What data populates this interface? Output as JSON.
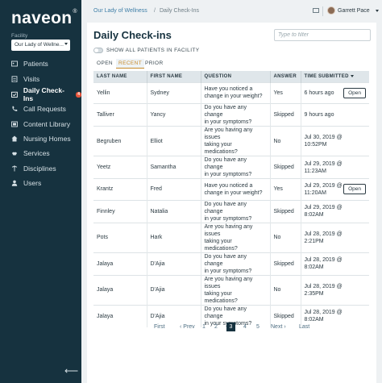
{
  "brand": {
    "logo_text": "naveon",
    "trademark": "®"
  },
  "facility": {
    "label": "Facility",
    "selected": "Our Lady of Wellne..."
  },
  "sidebar": {
    "items": [
      {
        "label": "Patients",
        "icon": "id-card-icon",
        "active": false
      },
      {
        "label": "Visits",
        "icon": "clipboard-icon",
        "active": false
      },
      {
        "label": "Daily Check-Ins",
        "icon": "calendar-check-icon",
        "active": true,
        "badge": "4"
      },
      {
        "label": "Call Requests",
        "icon": "phone-icon",
        "active": false
      },
      {
        "label": "Content Library",
        "icon": "library-icon",
        "active": false
      },
      {
        "label": "Nursing Homes",
        "icon": "building-icon",
        "active": false
      },
      {
        "label": "Services",
        "icon": "services-icon",
        "active": false
      },
      {
        "label": "Disciplines",
        "icon": "disciplines-icon",
        "active": false
      },
      {
        "label": "Users",
        "icon": "user-icon",
        "active": false
      }
    ],
    "collapse_glyph": "⟵"
  },
  "breadcrumb": {
    "parent": "Our Lady of Wellness",
    "separator": "/",
    "current": "Daily Check-Ins"
  },
  "user": {
    "name": "Garrett Pace"
  },
  "page": {
    "title": "Daily Check-ins",
    "filter_placeholder": "Type to filter",
    "toggle_label": "SHOW ALL PATIENTS IN FACILITY",
    "tabs": [
      {
        "label": "OPEN",
        "active": false
      },
      {
        "label": "RECENT",
        "active": true
      },
      {
        "label": "PRIOR",
        "active": false
      }
    ]
  },
  "table": {
    "headers": [
      "LAST NAME",
      "FIRST NAME",
      "QUESTION",
      "ANSWER",
      "TIME SUBMITTED"
    ],
    "open_label": "Open",
    "rows": [
      {
        "last": "Yellin",
        "first": "Sydney",
        "q1": "Have you noticed a",
        "q2": "change in your weight?",
        "answer": "Yes",
        "t1": "6 hours ago",
        "t2": "",
        "open": true
      },
      {
        "last": "Talliver",
        "first": "Yancy",
        "q1": "Do you have any change",
        "q2": "in your symptoms?",
        "answer": "Skipped",
        "t1": "9 hours ago",
        "t2": "",
        "open": false
      },
      {
        "last": "Begruben",
        "first": "Elliot",
        "q1": "Are you having any issues",
        "q2": "taking your medications?",
        "answer": "No",
        "t1": "Jul 30, 2019 @",
        "t2": "10:52PM",
        "open": false
      },
      {
        "last": "Yeetz",
        "first": "Samantha",
        "q1": "Do you have any change",
        "q2": "in your symptoms?",
        "answer": "Skipped",
        "t1": "Jul 29, 2019 @",
        "t2": "11:23AM",
        "open": false
      },
      {
        "last": "Krantz",
        "first": "Fred",
        "q1": "Have you noticed a",
        "q2": "change in your weight?",
        "answer": "Yes",
        "t1": "Jul 29, 2019 @",
        "t2": "11:20AM",
        "open": true
      },
      {
        "last": "Finnley",
        "first": "Natalia",
        "q1": "Do you have any change",
        "q2": "in your symptoms?",
        "answer": "Skipped",
        "t1": "Jul 29, 2019 @",
        "t2": "8:02AM",
        "open": false
      },
      {
        "last": "Pots",
        "first": "Hark",
        "q1": "Are you having any issues",
        "q2": "taking your medications?",
        "answer": "No",
        "t1": "Jul 28, 2019 @",
        "t2": "2:21PM",
        "open": false
      },
      {
        "last": "Jalaya",
        "first": "D'Ajia",
        "q1": "Do you have any change",
        "q2": "in your symptoms?",
        "answer": "Skipped",
        "t1": "Jul 28, 2019 @",
        "t2": "8:02AM",
        "open": false
      },
      {
        "last": "Jalaya",
        "first": "D'Ajia",
        "q1": "Are you having any issues",
        "q2": "taking your medications?",
        "answer": "No",
        "t1": "Jul 28, 2019 @",
        "t2": "2:35PM",
        "open": false
      },
      {
        "last": "Jalaya",
        "first": "D'Ajia",
        "q1": "Do you have any change",
        "q2": "in your symptoms?",
        "answer": "Skipped",
        "t1": "Jul 28, 2019 @",
        "t2": "8:02AM",
        "open": false
      }
    ]
  },
  "pagination": {
    "first": "First",
    "prev": "‹ Prev",
    "pages": [
      "1",
      "2",
      "3",
      "4",
      "5"
    ],
    "current": "3",
    "next": "Next ›",
    "last": "Last"
  },
  "colors": {
    "sidebar_bg": "#16323f",
    "accent": "#c88a2b",
    "link": "#3f7fa8",
    "badge": "#e8553b"
  }
}
